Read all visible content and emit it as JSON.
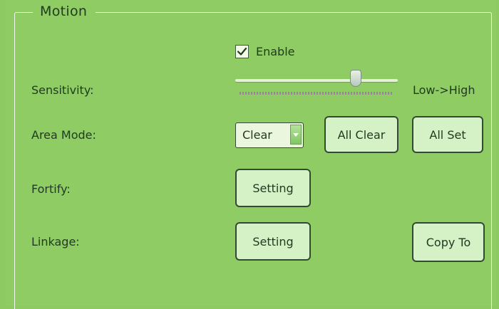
{
  "group": {
    "title": "Motion"
  },
  "enable": {
    "label": "Enable",
    "checked": true
  },
  "sensitivity": {
    "label": "Sensitivity:",
    "hint": "Low->High",
    "level": 0.74
  },
  "area_mode": {
    "label": "Area Mode:",
    "selected": "Clear",
    "all_clear_label": "All Clear",
    "all_set_label": "All Set"
  },
  "fortify": {
    "label": "Fortify:",
    "setting_label": "Setting"
  },
  "linkage": {
    "label": "Linkage:",
    "setting_label": "Setting",
    "copy_label": "Copy To"
  },
  "icons": {
    "check": "checkmark-icon",
    "dropdown": "dropdown-arrow-icon"
  },
  "colors": {
    "background": "#8fcd64",
    "button": "#d5f2c6",
    "border": "#324a33"
  }
}
